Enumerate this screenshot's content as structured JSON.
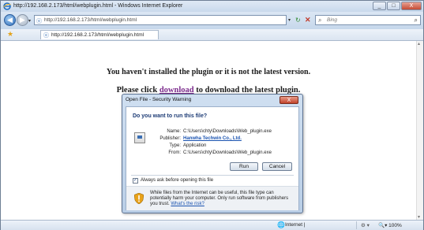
{
  "window": {
    "title": "http://192.168.2.173/html/webplugin.html - Windows Internet Explorer",
    "min_glyph": "_",
    "max_glyph": "□",
    "close_glyph": "X"
  },
  "navbar": {
    "back_glyph": "◀",
    "forward_glyph": "▶",
    "address": "http://192.168.2.173/html/webplugin.html",
    "search_placeholder": "Bing",
    "refresh_glyph": "↻",
    "stop_glyph": "✕",
    "search_glyph": "⌕",
    "search_go_glyph": "⌕"
  },
  "tab": {
    "title": "http://192.168.2.173/html/webplugin.html"
  },
  "page": {
    "message1": "You haven't installed the plugin or it is not the latest version.",
    "message2_prefix": "Please click",
    "message2_link": "download",
    "message2_suffix": "to download the latest plugin."
  },
  "dialog": {
    "title": "Open File - Security Warning",
    "close_glyph": "X",
    "question": "Do you want to run this file?",
    "fields": {
      "name_label": "Name:",
      "name_value": "C:\\Users\\chty\\Downloads\\Web_plugin.exe",
      "publisher_label": "Publisher:",
      "publisher_value": "Hanwha Techwin Co., Ltd.",
      "type_label": "Type:",
      "type_value": "Application",
      "from_label": "From:",
      "from_value": "C:\\Users\\chty\\Downloads\\Web_plugin.exe"
    },
    "run_label": "Run",
    "cancel_label": "Cancel",
    "checkbox_label": "Always ask before opening this file",
    "checkbox_checked": true,
    "checkbox_glyph": "✓",
    "warning_text": "While files from the Internet can be useful, this file type can potentially harm your computer. Only run software from publishers you trust.",
    "warning_link": "What's the risk?"
  },
  "statusbar": {
    "zone": "Internet |",
    "protected": "⚙ ▾",
    "zoom": "100%",
    "zoom_prefix": "🔍▾"
  }
}
